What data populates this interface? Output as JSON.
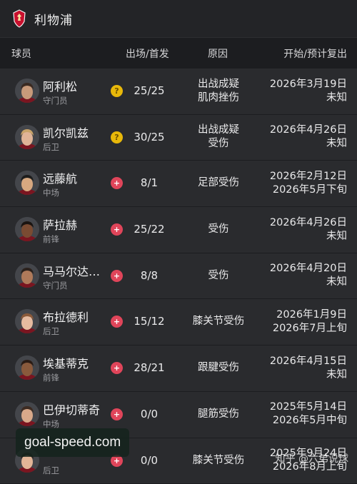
{
  "header": {
    "team_name": "利物浦",
    "crest_icon": "liverpool-crest-icon",
    "crest_color": "#c8102e"
  },
  "columns": {
    "player": "球员",
    "apps": "出场/首发",
    "reason": "原因",
    "return": "开始/预计复出"
  },
  "status_colors": {
    "doubt": "#e8b80a",
    "injured": "#e0455a"
  },
  "players": [
    {
      "name": "阿利松",
      "position": "守门员",
      "status": "doubt",
      "status_symbol": "?",
      "apps": "25/25",
      "reason": [
        "出战成疑",
        "肌肉挫伤"
      ],
      "return": [
        "2026年3月19日",
        "未知"
      ]
    },
    {
      "name": "凯尔凯兹",
      "position": "后卫",
      "status": "doubt",
      "status_symbol": "?",
      "apps": "30/25",
      "reason": [
        "出战成疑",
        "受伤"
      ],
      "return": [
        "2026年4月26日",
        "未知"
      ]
    },
    {
      "name": "远藤航",
      "position": "中场",
      "status": "injured",
      "status_symbol": "+",
      "apps": "8/1",
      "reason": [
        "足部受伤"
      ],
      "return": [
        "2026年2月12日",
        "2026年5月下旬"
      ]
    },
    {
      "name": "萨拉赫",
      "position": "前锋",
      "status": "injured",
      "status_symbol": "+",
      "apps": "25/22",
      "reason": [
        "受伤"
      ],
      "return": [
        "2026年4月26日",
        "未知"
      ]
    },
    {
      "name": "马马尔达…",
      "position": "守门员",
      "status": "injured",
      "status_symbol": "+",
      "apps": "8/8",
      "reason": [
        "受伤"
      ],
      "return": [
        "2026年4月20日",
        "未知"
      ]
    },
    {
      "name": "布拉德利",
      "position": "后卫",
      "status": "injured",
      "status_symbol": "+",
      "apps": "15/12",
      "reason": [
        "膝关节受伤"
      ],
      "return": [
        "2026年1月9日",
        "2026年7月上旬"
      ]
    },
    {
      "name": "埃基蒂克",
      "position": "前锋",
      "status": "injured",
      "status_symbol": "+",
      "apps": "28/21",
      "reason": [
        "跟腱受伤"
      ],
      "return": [
        "2026年4月15日",
        "未知"
      ]
    },
    {
      "name": "巴伊切蒂奇",
      "position": "中场",
      "status": "injured",
      "status_symbol": "+",
      "apps": "0/0",
      "reason": [
        "腿筋受伤"
      ],
      "return": [
        "2025年5月14日",
        "2026年5月中旬"
      ]
    },
    {
      "name": "",
      "position": "后卫",
      "status": "injured",
      "status_symbol": "+",
      "apps": "0/0",
      "reason": [
        "膝关节受伤"
      ],
      "return": [
        "2025年9月24日",
        "2026年8月上旬"
      ]
    }
  ],
  "watermarks": {
    "left": "goal-speed.com",
    "right": "知乎 @六弟说球"
  }
}
